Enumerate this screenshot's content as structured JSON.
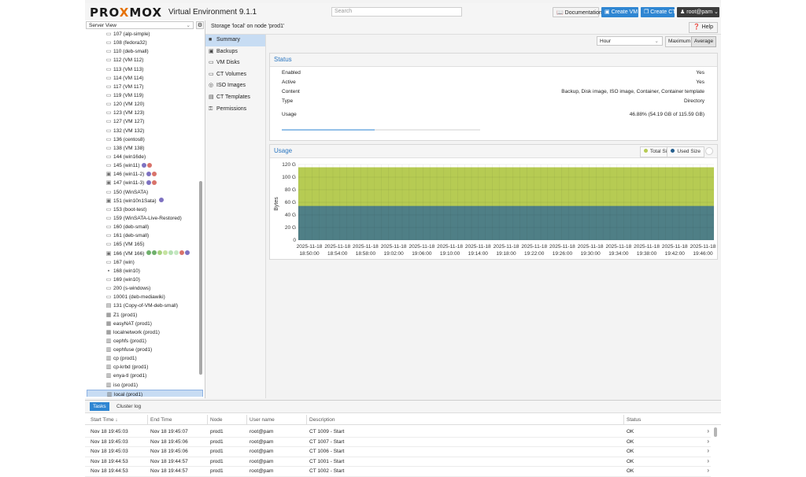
{
  "header": {
    "brand_pre": "PRO",
    "brand_x": "X",
    "brand_post": "MOX",
    "version": "Virtual Environment 9.1.1",
    "search_placeholder": "Search",
    "doc_label": "Documentation",
    "create_vm": "Create VM",
    "create_ct": "Create CT",
    "user": "root@pam"
  },
  "tree": {
    "view_label": "Server View",
    "items": [
      {
        "label": "107 (alp-simple)",
        "icon": "vm-icon"
      },
      {
        "label": "108 (fedora32)",
        "icon": "vm-icon"
      },
      {
        "label": "110 (deb-small)",
        "icon": "vm-icon"
      },
      {
        "label": "112 (VM 112)",
        "icon": "vm-icon"
      },
      {
        "label": "113 (VM 113)",
        "icon": "vm-icon"
      },
      {
        "label": "114 (VM 114)",
        "icon": "vm-icon"
      },
      {
        "label": "117 (VM 117)",
        "icon": "vm-icon"
      },
      {
        "label": "119 (VM 119)",
        "icon": "vm-icon"
      },
      {
        "label": "120 (VM 120)",
        "icon": "vm-icon"
      },
      {
        "label": "123 (VM 123)",
        "icon": "vm-icon"
      },
      {
        "label": "127 (VM 127)",
        "icon": "vm-icon"
      },
      {
        "label": "132 (VM 132)",
        "icon": "vm-icon"
      },
      {
        "label": "136 (centos8)",
        "icon": "vm-icon"
      },
      {
        "label": "138 (VM 138)",
        "icon": "vm-icon"
      },
      {
        "label": "144 (win16de)",
        "icon": "vm-icon"
      },
      {
        "label": "145 (win11)",
        "icon": "vm-icon",
        "dots": [
          "#7e72c1",
          "#d9736b"
        ]
      },
      {
        "label": "146 (win11-2)",
        "icon": "vm-running-icon",
        "dots": [
          "#7e72c1",
          "#d9736b"
        ]
      },
      {
        "label": "147 (win11-3)",
        "icon": "vm-running-icon",
        "dots": [
          "#7e72c1",
          "#d9736b"
        ]
      },
      {
        "label": "150 (WinSATA)",
        "icon": "vm-icon"
      },
      {
        "label": "151 (win10n1Sata)",
        "icon": "vm-running-icon",
        "dots": [
          "#7e72c1"
        ]
      },
      {
        "label": "153 (boot-test)",
        "icon": "vm-icon"
      },
      {
        "label": "159 (WinSATA-Live-Restored)",
        "icon": "vm-icon"
      },
      {
        "label": "160 (deb-small)",
        "icon": "vm-icon"
      },
      {
        "label": "161 (deb-small)",
        "icon": "vm-icon"
      },
      {
        "label": "165 (VM 165)",
        "icon": "vm-icon"
      },
      {
        "label": "166 (VM 166)",
        "icon": "vm-running-icon",
        "dots": [
          "#6fb06c",
          "#6fb06c",
          "#a7d27f",
          "#c6e3a1",
          "#b6e0b3",
          "#c5e8c2",
          "#d9736b",
          "#7e72c1"
        ]
      },
      {
        "label": "167 (win)",
        "icon": "vm-icon"
      },
      {
        "label": "168 (win10)",
        "icon": "vm-locked-icon"
      },
      {
        "label": "169 (win10)",
        "icon": "vm-icon"
      },
      {
        "label": "200 (s-windows)",
        "icon": "vm-icon"
      },
      {
        "label": "10001 (deb-mediawiki)",
        "icon": "vm-icon"
      },
      {
        "label": "131 (Copy-of-VM-deb-small)",
        "icon": "template-icon"
      },
      {
        "label": "Z1 (prod1)",
        "icon": "sdn-zone-icon"
      },
      {
        "label": "easyNAT (prod1)",
        "icon": "sdn-zone-icon"
      },
      {
        "label": "localnetwork (prod1)",
        "icon": "sdn-zone-icon"
      },
      {
        "label": "cephfs (prod1)",
        "icon": "storage-icon"
      },
      {
        "label": "cephfuse (prod1)",
        "icon": "storage-icon"
      },
      {
        "label": "cp (prod1)",
        "icon": "storage-icon"
      },
      {
        "label": "cp-krbd (prod1)",
        "icon": "storage-icon"
      },
      {
        "label": "enya-tl (prod1)",
        "icon": "storage-icon"
      },
      {
        "label": "iso (prod1)",
        "icon": "storage-icon"
      },
      {
        "label": "local (prod1)",
        "icon": "storage-icon",
        "selected": true
      }
    ]
  },
  "breadcrumb": "Storage 'local' on node 'prod1'",
  "help_label": "Help",
  "nav": [
    {
      "label": "Summary",
      "icon": "book-icon",
      "selected": true
    },
    {
      "label": "Backups",
      "icon": "floppy-icon"
    },
    {
      "label": "VM Disks",
      "icon": "hdd-icon"
    },
    {
      "label": "CT Volumes",
      "icon": "hdd-icon"
    },
    {
      "label": "ISO Images",
      "icon": "disc-icon"
    },
    {
      "label": "CT Templates",
      "icon": "file-icon"
    },
    {
      "label": "Permissions",
      "icon": "key-icon"
    }
  ],
  "controls": {
    "timeframe": "Hour",
    "maximum_label": "Maximum",
    "average_label": "Average"
  },
  "status": {
    "title": "Status",
    "rows": [
      {
        "key": "Enabled",
        "value": "Yes"
      },
      {
        "key": "Active",
        "value": "Yes"
      },
      {
        "key": "Content",
        "value": "Backup, Disk image, ISO image, Container, Container template"
      },
      {
        "key": "Type",
        "value": "Directory"
      },
      {
        "key": "Usage",
        "value": "46.88% (54.19 GB of 115.59 GB)"
      }
    ],
    "usage_fraction": 0.4688
  },
  "usage": {
    "title": "Usage",
    "legend": [
      {
        "name": "Total Size",
        "color": "#b6cb53"
      },
      {
        "name": "Used Size",
        "color": "#245e8d"
      }
    ]
  },
  "chart_data": {
    "type": "area",
    "title": "Usage",
    "ylabel": "Bytes",
    "ylim": [
      0,
      120
    ],
    "yticks": [
      "0",
      "20 G",
      "40 G",
      "60 G",
      "80 G",
      "100 G",
      "120 G"
    ],
    "x_labels": [
      [
        "2025-11-18",
        "18:50:00"
      ],
      [
        "2025-11-18",
        "18:54:00"
      ],
      [
        "2025-11-18",
        "18:58:00"
      ],
      [
        "2025-11-18",
        "19:02:00"
      ],
      [
        "2025-11-18",
        "19:06:00"
      ],
      [
        "2025-11-18",
        "19:10:00"
      ],
      [
        "2025-11-18",
        "19:14:00"
      ],
      [
        "2025-11-18",
        "19:18:00"
      ],
      [
        "2025-11-18",
        "19:22:00"
      ],
      [
        "2025-11-18",
        "19:26:00"
      ],
      [
        "2025-11-18",
        "19:30:00"
      ],
      [
        "2025-11-18",
        "19:34:00"
      ],
      [
        "2025-11-18",
        "19:38:00"
      ],
      [
        "2025-11-18",
        "19:42:00"
      ],
      [
        "2025-11-18",
        "19:46:00"
      ]
    ],
    "series": [
      {
        "name": "Total Size",
        "value": 115.59,
        "color": "#b6cb53"
      },
      {
        "name": "Used Size",
        "value": 54.19,
        "color": "#4f7f86"
      }
    ]
  },
  "bottom": {
    "tabs": [
      "Tasks",
      "Cluster log"
    ],
    "columns": [
      "Start Time ↓",
      "End Time",
      "Node",
      "User name",
      "Description",
      "Status"
    ],
    "rows": [
      [
        "Nov 18 19:45:03",
        "Nov 18 19:45:07",
        "prod1",
        "root@pam",
        "CT 1009 - Start",
        "OK"
      ],
      [
        "Nov 18 19:45:03",
        "Nov 18 19:45:06",
        "prod1",
        "root@pam",
        "CT 1007 - Start",
        "OK"
      ],
      [
        "Nov 18 19:45:03",
        "Nov 18 19:45:06",
        "prod1",
        "root@pam",
        "CT 1006 - Start",
        "OK"
      ],
      [
        "Nov 18 19:44:53",
        "Nov 18 19:44:57",
        "prod1",
        "root@pam",
        "CT 1001 - Start",
        "OK"
      ],
      [
        "Nov 18 19:44:53",
        "Nov 18 19:44:57",
        "prod1",
        "root@pam",
        "CT 1002 - Start",
        "OK"
      ]
    ]
  }
}
